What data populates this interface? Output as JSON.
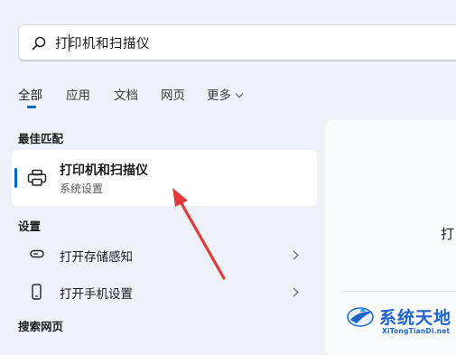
{
  "search": {
    "query": "打印机和扫描仪"
  },
  "tabs": [
    {
      "label": "全部"
    },
    {
      "label": "应用"
    },
    {
      "label": "文档"
    },
    {
      "label": "网页"
    },
    {
      "label": "更多"
    }
  ],
  "best_match": {
    "section_title": "最佳匹配",
    "title": "打印机和扫描仪",
    "subtitle": "系统设置"
  },
  "settings": {
    "section_title": "设置",
    "items": [
      {
        "label": "打开存储感知"
      },
      {
        "label": "打开手机设置"
      }
    ]
  },
  "web": {
    "section_title": "搜索网页"
  },
  "right_panel": {
    "text": "打"
  },
  "watermark": {
    "name": "系统天地",
    "url": "XiTongTianDi.net"
  },
  "colors": {
    "accent": "#0067c0",
    "arrow": "#e23b3b",
    "watermark": "#1e63c8"
  },
  "icons": {
    "search": "search-icon",
    "printer": "printer-icon",
    "storage": "storage-icon",
    "phone": "phone-icon",
    "more_dropdown": "chevron-down-icon",
    "item_arrow": "chevron-right-icon"
  }
}
